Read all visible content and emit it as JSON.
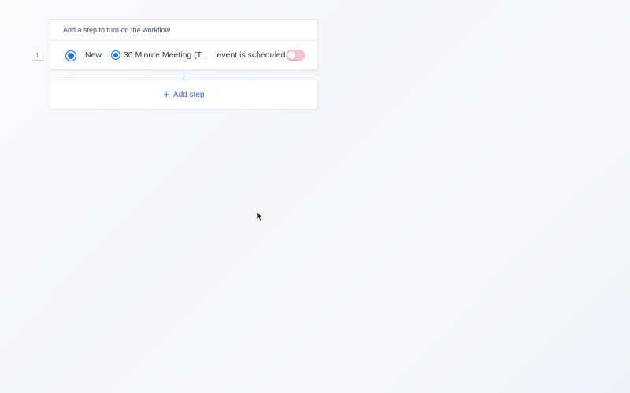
{
  "workflow": {
    "header_text": "Add a step to turn on the workflow",
    "steps": [
      {
        "number": "1",
        "app_icon": "calendly-icon",
        "prefix": "New",
        "meeting_name": "30 Minute Meeting (T...",
        "event_text": "event is scheduled",
        "toggle_label": "Off",
        "toggle_state": "off"
      }
    ],
    "add_step_label": "Add step",
    "add_step_icon": "plus-icon"
  },
  "colors": {
    "accent": "#3b5bdb",
    "app_icon": "#1a73e8",
    "toggle_off": "#f5c7cc"
  }
}
